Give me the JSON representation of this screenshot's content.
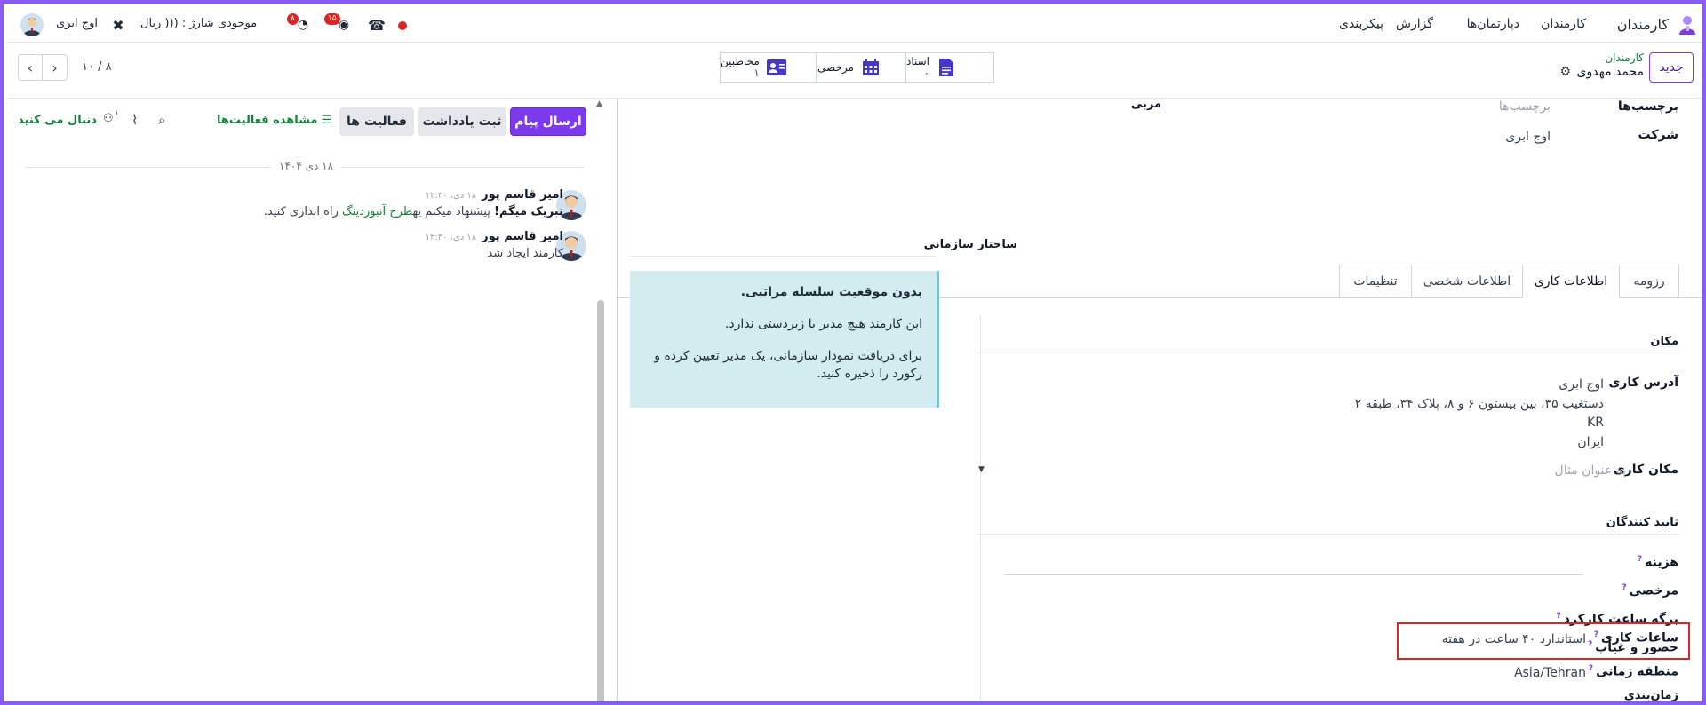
{
  "navbar": {
    "app_name": "کارمندان",
    "menu": [
      "کارمندان",
      "دپارتمان‌ها",
      "گزارش",
      "پیکربندی"
    ],
    "company": "اوج ابری",
    "wallet": "موجودی شارژ : ((( ریال",
    "activity_badge": "۸",
    "chat_badge": "۱۵"
  },
  "control": {
    "new_label": "جدید",
    "breadcrumb_parent": "کارمندان",
    "record_name": "محمد مهدوی",
    "pager": "۸ / ۱۰",
    "smart_buttons": [
      {
        "label": "اسناد",
        "value": "۰"
      },
      {
        "label": "مرخصی",
        "value": ""
      },
      {
        "label": "مخاطبین",
        "value": "۱"
      }
    ]
  },
  "form": {
    "tags_label": "برچسب‌ها",
    "tags_placeholder": "برچسب‌ها",
    "coach_label": "مربی",
    "company_label": "شرکت",
    "company_value": "اوج ابری",
    "tabs": [
      "رزومه",
      "اطلاعات کاری",
      "اطلاعات شخصی",
      "تنظیمات"
    ],
    "location_header": "مکان",
    "work_address_label": "آدرس کاری",
    "work_address_lines": [
      "اوج ابری",
      "دستغیب ۳۵، بین بیستون ۶ و ۸، پلاک ۳۴، طبقه ۲",
      "KR",
      "ایران"
    ],
    "work_location_label": "مکان کاری",
    "work_location_placeholder": "به عنوان مثال",
    "approvers_header": "تایید کنندگان",
    "expense_label": "هزینه",
    "timeoff_label": "مرخصی",
    "timesheet_label": "برگه ساعت کارکرد",
    "attendance_label": "حضور و غیاب",
    "schedule_header": "زمان‌بندی",
    "working_hours_label": "ساعات کاری",
    "working_hours_value": "استاندارد ۴۰ ساعت در هفته",
    "timezone_label": "منطقه زمانی",
    "timezone_value": "Asia/Tehran",
    "qmark": "?"
  },
  "org": {
    "title": "ساختار سازمانی",
    "alert_title": "بدون موقعیت سلسله مراتبی.",
    "alert_line1": "این کارمند هیچ مدیر یا زیردستی ندارد.",
    "alert_line2": "برای دریافت نمودار سازمانی، یک مدیر تعیین کرده و رکورد را ذخیره کنید."
  },
  "chatter": {
    "send_message": "ارسال پیام",
    "log_note": "ثبت یادداشت",
    "activities": "فعالیت ها",
    "view_activities": "مشاهده فعالیت‌ها",
    "follow": "دنبال می کنید",
    "followers_count": "۱",
    "date_separator": "۱۸ دی ۱۴۰۴",
    "messages": [
      {
        "author": "امیر قاسم پور",
        "time": "۱۸ دی، ۱۲:۳۰",
        "bold": "تبریک میگم!",
        "text_before": " پیشنهاد میکنم یه",
        "link": "طرح آنبوردینگ",
        "text_after": " راه اندازی کنید."
      },
      {
        "author": "امیر قاسم پور",
        "time": "۱۸ دی، ۱۲:۳۰",
        "text": "کارمند ایجاد شد"
      }
    ]
  }
}
